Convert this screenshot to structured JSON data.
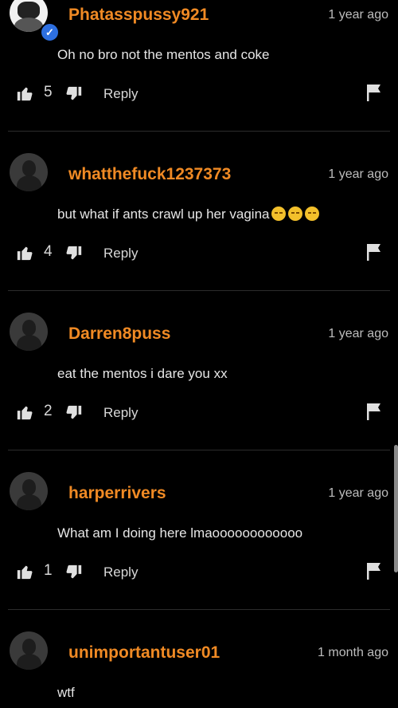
{
  "accent": "#f08a24",
  "reply_label": "Reply",
  "comments": [
    {
      "username": "Phatasspussy921",
      "time": "1 year ago",
      "text": "Oh no bro not the mentos and coke",
      "likes": "5",
      "emoji_count": 0,
      "verified": true
    },
    {
      "username": "whatthefuck1237373",
      "time": "1 year ago",
      "text": "but what if ants crawl up her vagina",
      "likes": "4",
      "emoji_count": 3,
      "emoji_icon": "disappointed-face-icon"
    },
    {
      "username": "Darren8puss",
      "time": "1 year ago",
      "text": "eat the mentos i dare you xx",
      "likes": "2",
      "emoji_count": 0
    },
    {
      "username": "harperrivers",
      "time": "1 year ago",
      "text": "What am I doing here lmaoooooooooooo",
      "likes": "1",
      "emoji_count": 0
    },
    {
      "username": "unimportantuser01",
      "time": "1 month ago",
      "text": "wtf",
      "likes": "",
      "emoji_count": 0
    }
  ]
}
